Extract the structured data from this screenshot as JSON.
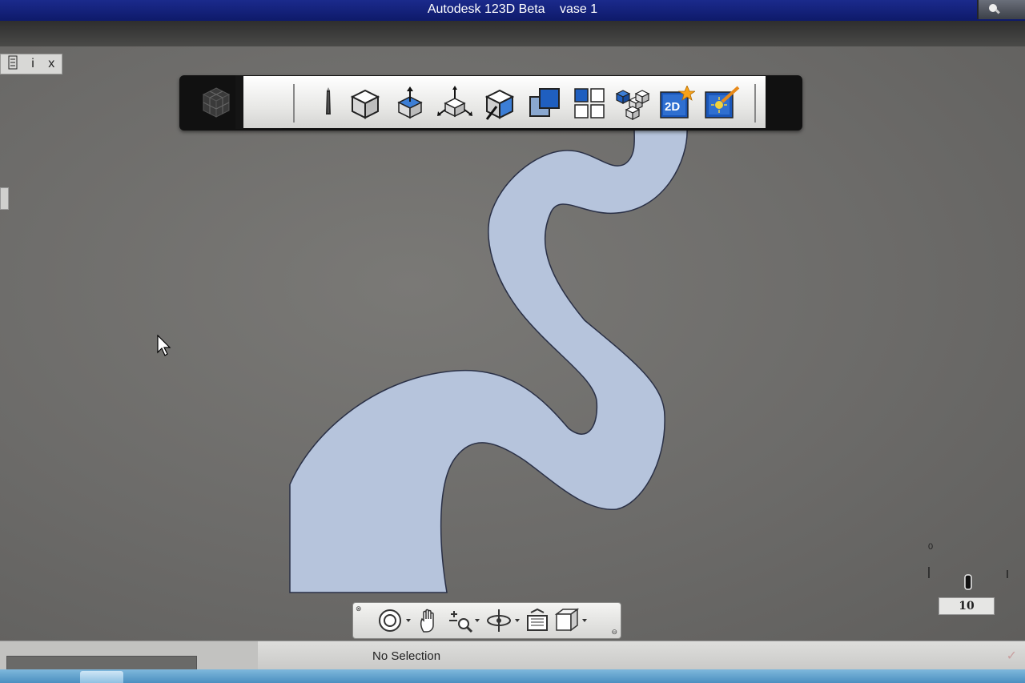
{
  "window": {
    "app_title": "Autodesk 123D Beta",
    "doc_title": "vase 1"
  },
  "panel_controls": {
    "icons": [
      "calculator-icon",
      "info-icon",
      "close-icon"
    ],
    "info_glyph": "i",
    "close_glyph": "x"
  },
  "toolbar": {
    "buttons": [
      "sketch-pencil-icon",
      "primitives-box-icon",
      "extrude-icon",
      "move-transform-icon",
      "inspect-icon",
      "combine-icon",
      "pattern-icon",
      "group-blocks-icon",
      "drawing-2d-icon",
      "render-icon"
    ],
    "label_2d": "2D"
  },
  "navigation_bar": {
    "buttons": [
      "steering-wheel-icon",
      "pan-hand-icon",
      "zoom-icon",
      "orbit-icon",
      "fit-view-icon",
      "view-cube-icon"
    ]
  },
  "scale": {
    "zero_label": "0",
    "value": "10"
  },
  "status": {
    "text": "No Selection"
  },
  "colors": {
    "title_bar": "#14237a",
    "sketch_fill": "#b6c4dc",
    "sketch_stroke": "#2a3046",
    "viewport": "#6d6c6a"
  }
}
